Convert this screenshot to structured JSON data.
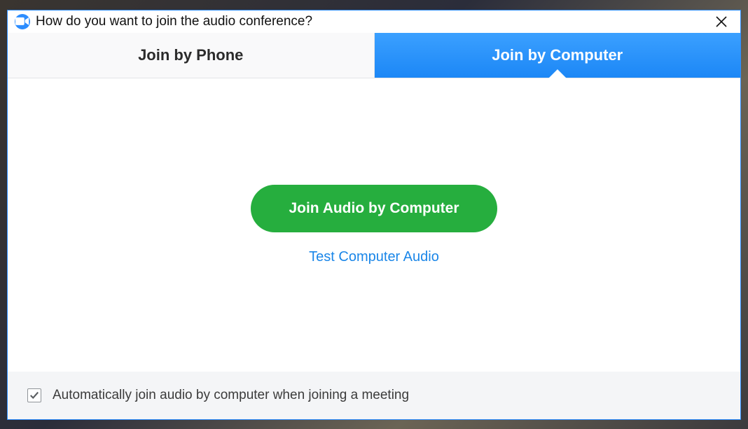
{
  "window": {
    "title": "How do you want to join the audio conference?"
  },
  "tabs": {
    "phone": "Join by Phone",
    "computer": "Join by Computer"
  },
  "main": {
    "primary_button": "Join Audio by Computer",
    "test_link": "Test Computer Audio"
  },
  "footer": {
    "checkbox_checked": true,
    "label": "Automatically join audio by computer when joining a meeting"
  }
}
